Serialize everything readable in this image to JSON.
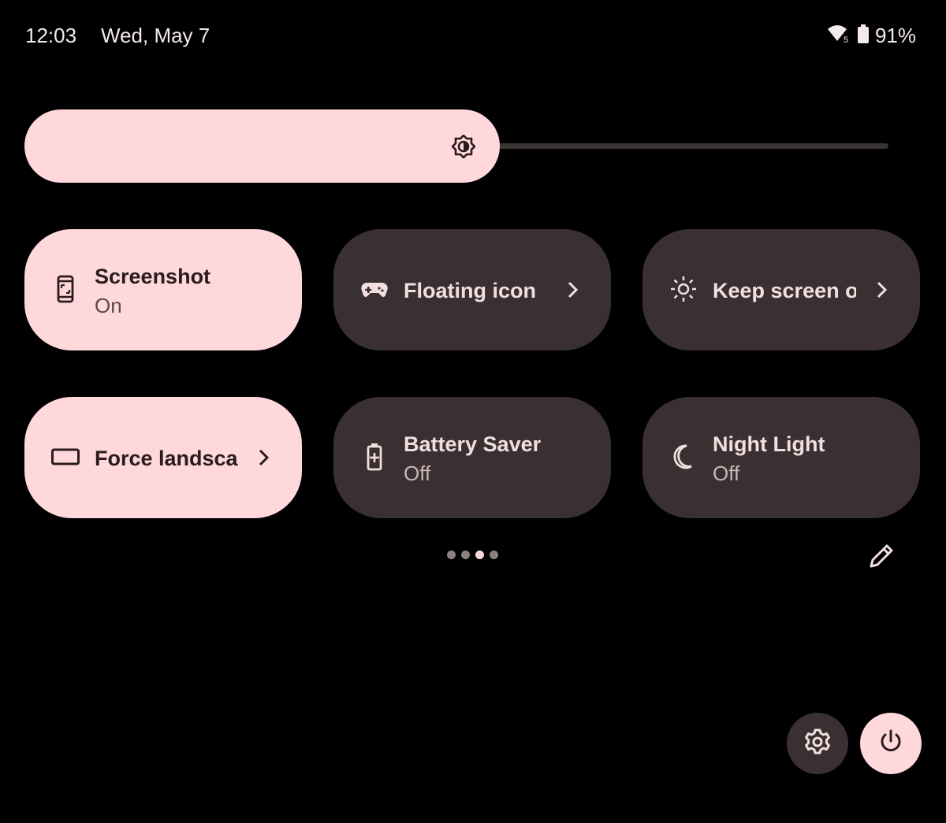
{
  "status_bar": {
    "time": "12:03",
    "date": "Wed, May 7",
    "wifi_icon": "wifi-5-icon",
    "wifi_badge": "5",
    "battery_icon": "battery-icon",
    "battery_percent": "91%"
  },
  "brightness": {
    "icon": "brightness-icon",
    "level": 0.55
  },
  "tiles": [
    {
      "label": "Screenshot",
      "sub": "On",
      "icon": "screenshot-icon",
      "state": "on"
    },
    {
      "label": "Floating icon",
      "sub": "",
      "icon": "gamepad-icon",
      "state": "off",
      "chevron": true
    },
    {
      "label": "Keep screen on",
      "sub": "",
      "icon": "sun-icon",
      "state": "off",
      "chevron": true
    },
    {
      "label": "Force landscape",
      "sub": "",
      "icon": "landscape-icon",
      "state": "on",
      "chevron": true
    },
    {
      "label": "Battery Saver",
      "sub": "Off",
      "icon": "battery-saver-icon",
      "state": "off"
    },
    {
      "label": "Night Light",
      "sub": "Off",
      "icon": "moon-icon",
      "state": "off"
    }
  ],
  "pager": {
    "count": 4,
    "active_index": 2
  },
  "actions": {
    "edit_icon": "pencil-icon",
    "settings_icon": "gear-icon",
    "power_icon": "power-icon"
  },
  "colors": {
    "accent": "#ffd8dc",
    "tile_off": "#3a3032",
    "background": "#000000"
  }
}
